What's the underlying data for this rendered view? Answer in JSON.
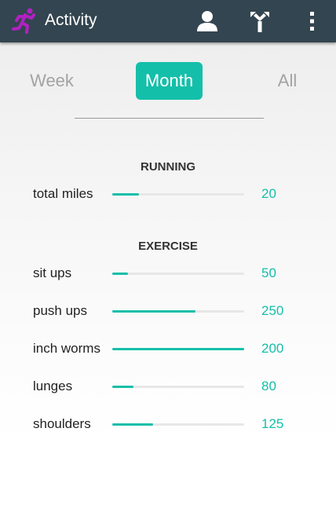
{
  "appbar": {
    "title": "Activity",
    "logo_icon": "running-figure-icon",
    "actions": [
      {
        "icon": "person-icon"
      },
      {
        "icon": "share-arrows-icon"
      },
      {
        "icon": "overflow-menu-icon"
      }
    ]
  },
  "tabs": {
    "items": [
      {
        "label": "Week",
        "selected": false
      },
      {
        "label": "Month",
        "selected": true
      },
      {
        "label": "All",
        "selected": false
      }
    ]
  },
  "sections": [
    {
      "title": "RUNNING",
      "items": [
        {
          "label": "total miles",
          "value": "20",
          "progress": 0.2
        }
      ]
    },
    {
      "title": "EXERCISE",
      "items": [
        {
          "label": "sit ups",
          "value": "50",
          "progress": 0.12
        },
        {
          "label": "push ups",
          "value": "250",
          "progress": 0.63
        },
        {
          "label": "inch worms",
          "value": "200",
          "progress": 1.0
        },
        {
          "label": "lunges",
          "value": "80",
          "progress": 0.16
        },
        {
          "label": "shoulders",
          "value": "125",
          "progress": 0.31
        }
      ]
    }
  ],
  "colors": {
    "appbar": "#334550",
    "accent": "#14bfa9",
    "logo": "#b221c2",
    "track": "#e7e7e7"
  }
}
